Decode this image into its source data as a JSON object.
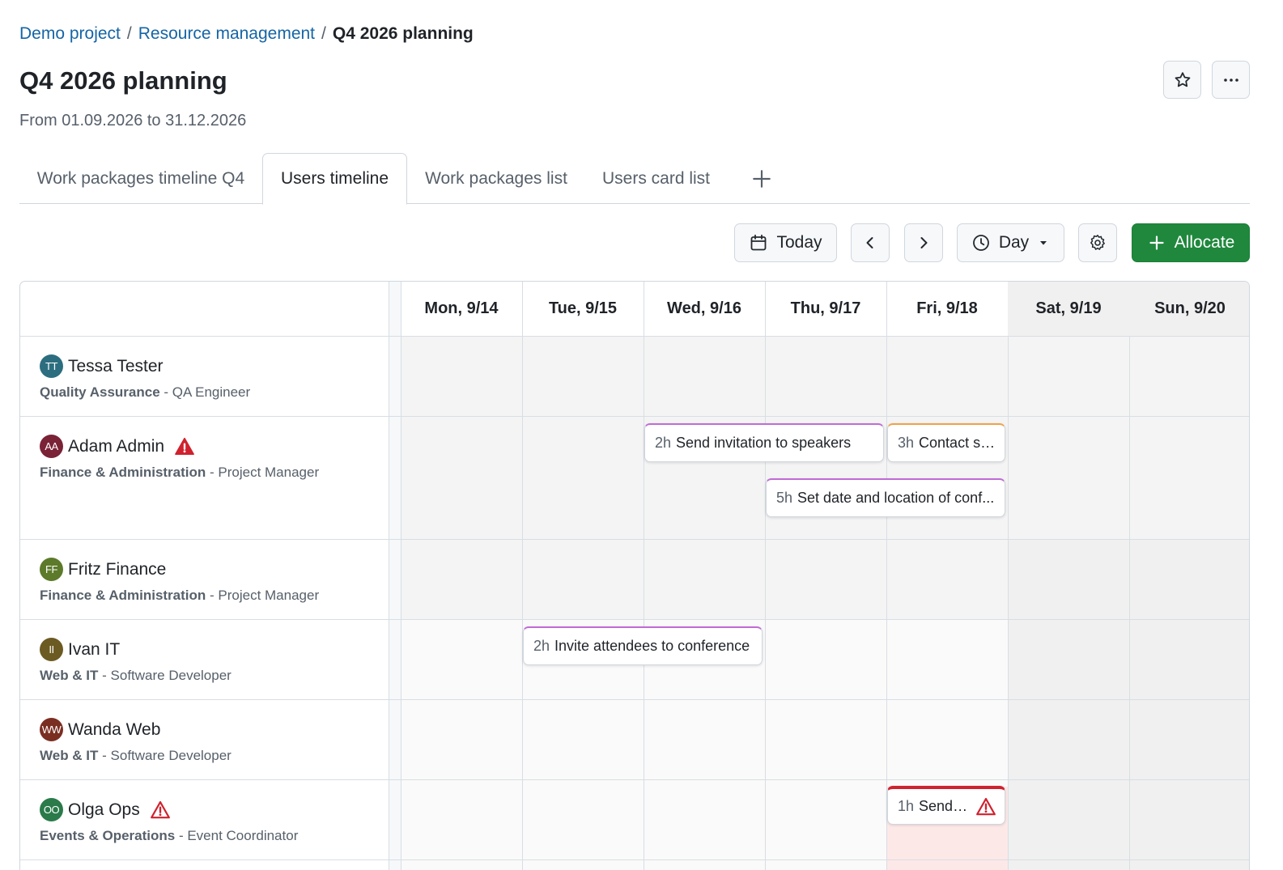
{
  "breadcrumb": {
    "items": [
      "Demo project",
      "Resource management"
    ],
    "separator": "/",
    "current": "Q4 2026 planning"
  },
  "page": {
    "title": "Q4 2026 planning",
    "subtitle": "From 01.09.2026 to 31.12.2026"
  },
  "tabs": [
    {
      "label": "Work packages timeline Q4",
      "active": false
    },
    {
      "label": "Users timeline",
      "active": true
    },
    {
      "label": "Work packages list",
      "active": false
    },
    {
      "label": "Users card list",
      "active": false
    }
  ],
  "toolbar": {
    "today_label": "Today",
    "view_label": "Day",
    "allocate_label": "Allocate"
  },
  "days": [
    "Mon, 9/14",
    "Tue, 9/15",
    "Wed, 9/16",
    "Thu, 9/17",
    "Fri, 9/18",
    "Sat, 9/19",
    "Sun, 9/20"
  ],
  "users": [
    {
      "initials": "TT",
      "name": "Tessa Tester",
      "group": "Quality Assurance",
      "role": "QA Engineer",
      "avatar_color": "#2c6e7f",
      "warning": false
    },
    {
      "initials": "AA",
      "name": "Adam Admin",
      "group": "Finance & Administration",
      "role": "Project Manager",
      "avatar_color": "#7a2236",
      "warning": true
    },
    {
      "initials": "FF",
      "name": "Fritz Finance",
      "group": "Finance & Administration",
      "role": "Project Manager",
      "avatar_color": "#5c7a2a",
      "warning": false
    },
    {
      "initials": "II",
      "name": "Ivan IT",
      "group": "Web & IT",
      "role": "Software Developer",
      "avatar_color": "#6b5a22",
      "warning": false
    },
    {
      "initials": "WW",
      "name": "Wanda Web",
      "group": "Web & IT",
      "role": "Software Developer",
      "avatar_color": "#7a2e22",
      "warning": false
    },
    {
      "initials": "OO",
      "name": "Olga Ops",
      "group": "Events & Operations",
      "role": "Event Coordinator",
      "avatar_color": "#2a7a4a",
      "warning": true
    }
  ],
  "role_separator": " - ",
  "allocations": [
    {
      "hours": "2h",
      "title": "Send invitation to speakers",
      "accent": "#c06bd6",
      "warning": false
    },
    {
      "hours": "3h",
      "title": "Contact sp...",
      "accent": "#f0a247",
      "warning": false
    },
    {
      "hours": "5h",
      "title": "Set date and location of conf...",
      "accent": "#c06bd6",
      "warning": false
    },
    {
      "hours": "2h",
      "title": "Invite attendees to conference",
      "accent": "#c06bd6",
      "warning": false
    },
    {
      "hours": "1h",
      "title": "Send i...",
      "accent": "#cf222e",
      "warning": true
    }
  ],
  "colors": {
    "link": "#1565a6",
    "primary_button": "#1f883d",
    "warning": "#cf222e",
    "weekend_bg": "#f0f0f0",
    "overload_bg": "#fde8e8"
  }
}
